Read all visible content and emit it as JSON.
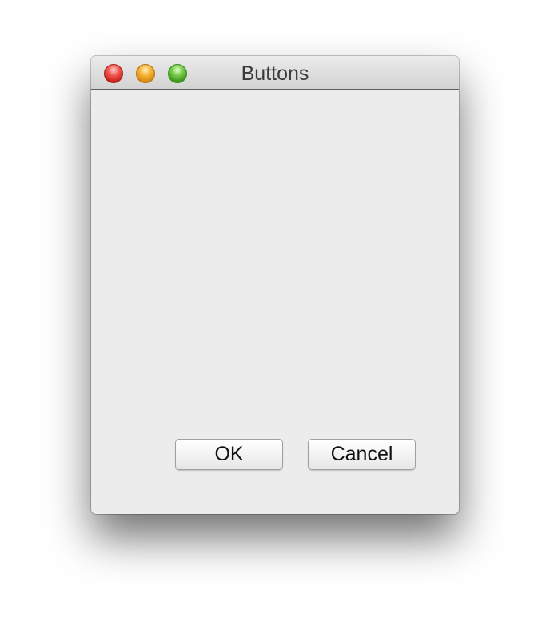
{
  "window": {
    "title": "Buttons"
  },
  "buttons": {
    "ok_label": "OK",
    "cancel_label": "Cancel"
  }
}
